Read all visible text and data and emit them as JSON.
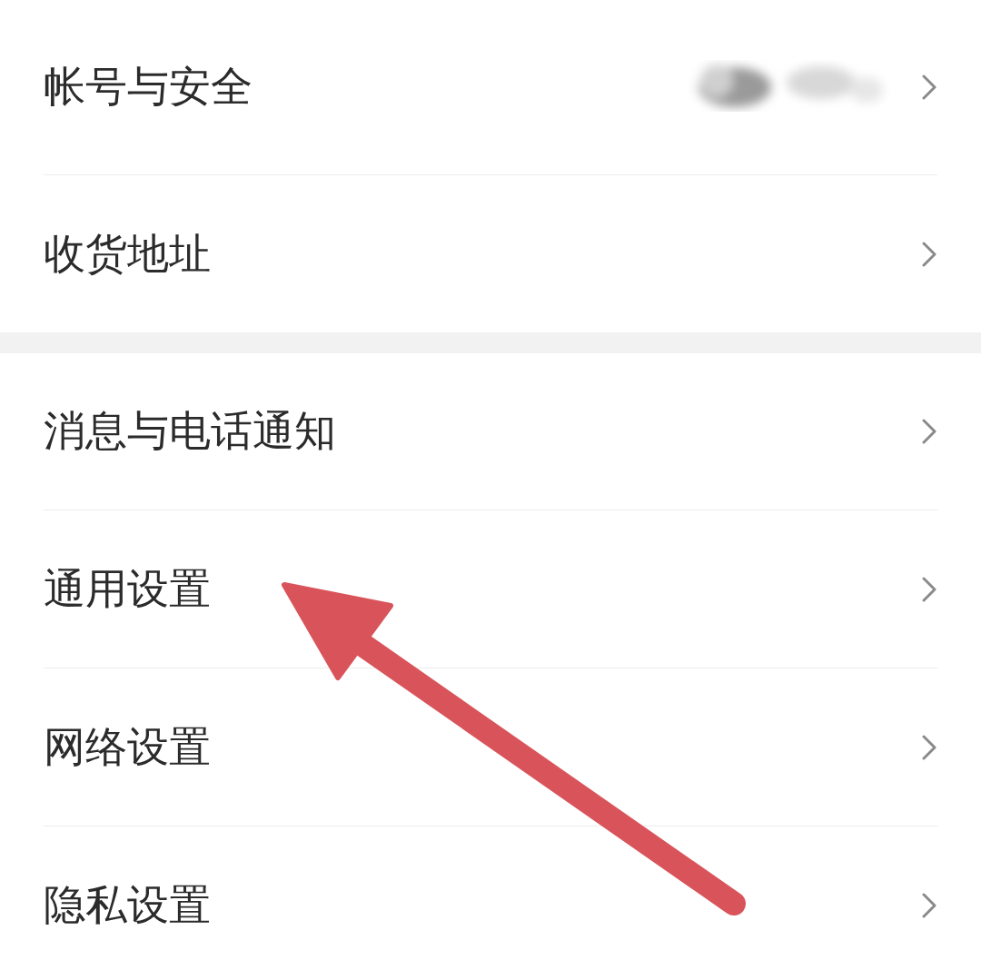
{
  "sections": [
    {
      "items": [
        {
          "label": "帐号与安全",
          "kind": "masked"
        },
        {
          "label": "收货地址",
          "kind": "link"
        }
      ]
    },
    {
      "items": [
        {
          "label": "消息与电话通知",
          "kind": "link"
        },
        {
          "label": "通用设置",
          "kind": "link"
        },
        {
          "label": "网络设置",
          "kind": "link"
        },
        {
          "label": "隐私设置",
          "kind": "link"
        }
      ]
    }
  ]
}
